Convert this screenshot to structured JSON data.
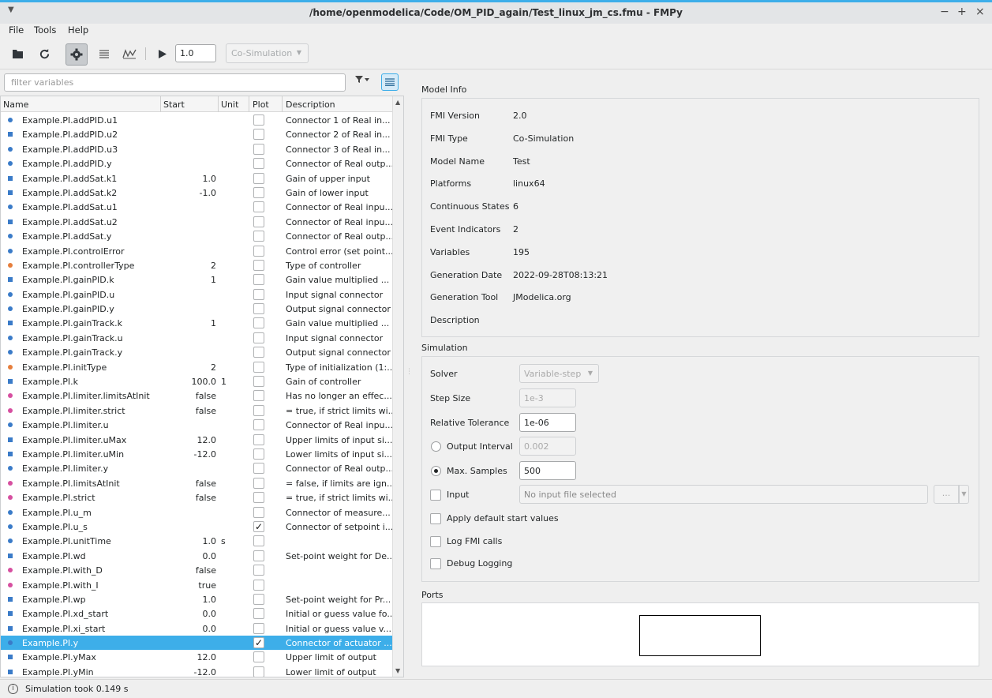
{
  "window": {
    "title": "/home/openmodelica/Code/OM_PID_again/Test_linux_jm_cs.fmu - FMPy",
    "controls": [
      "−",
      "+",
      "×"
    ]
  },
  "menu": [
    "File",
    "Tools",
    "Help"
  ],
  "toolbar": {
    "stop_time": "1.0",
    "interface_type": "Co-Simulation"
  },
  "filter": {
    "placeholder": "filter variables"
  },
  "table": {
    "columns": [
      "Name",
      "Start",
      "Unit",
      "Plot",
      "Description"
    ],
    "rows": [
      {
        "name": "Example.PI.addPID.u1",
        "start": "",
        "unit": "",
        "plot": false,
        "desc": "Connector 1 of Real in...",
        "icon": "circle",
        "color": "#3a7bc8"
      },
      {
        "name": "Example.PI.addPID.u2",
        "start": "",
        "unit": "",
        "plot": false,
        "desc": "Connector 2 of Real in...",
        "icon": "square",
        "color": "#3a7bc8"
      },
      {
        "name": "Example.PI.addPID.u3",
        "start": "",
        "unit": "",
        "plot": false,
        "desc": "Connector 3 of Real in...",
        "icon": "circle",
        "color": "#3a7bc8"
      },
      {
        "name": "Example.PI.addPID.y",
        "start": "",
        "unit": "",
        "plot": false,
        "desc": "Connector of Real outp...",
        "icon": "circle",
        "color": "#3a7bc8"
      },
      {
        "name": "Example.PI.addSat.k1",
        "start": "1.0",
        "unit": "",
        "plot": false,
        "desc": "Gain of upper input",
        "icon": "square",
        "color": "#3a7bc8"
      },
      {
        "name": "Example.PI.addSat.k2",
        "start": "-1.0",
        "unit": "",
        "plot": false,
        "desc": "Gain of lower input",
        "icon": "square",
        "color": "#3a7bc8"
      },
      {
        "name": "Example.PI.addSat.u1",
        "start": "",
        "unit": "",
        "plot": false,
        "desc": "Connector of Real inpu...",
        "icon": "circle",
        "color": "#3a7bc8"
      },
      {
        "name": "Example.PI.addSat.u2",
        "start": "",
        "unit": "",
        "plot": false,
        "desc": "Connector of Real inpu...",
        "icon": "square",
        "color": "#3a7bc8"
      },
      {
        "name": "Example.PI.addSat.y",
        "start": "",
        "unit": "",
        "plot": false,
        "desc": "Connector of Real outp...",
        "icon": "circle",
        "color": "#3a7bc8"
      },
      {
        "name": "Example.PI.controlError",
        "start": "",
        "unit": "",
        "plot": false,
        "desc": "Control error (set point...",
        "icon": "circle",
        "color": "#3a7bc8"
      },
      {
        "name": "Example.PI.controllerType",
        "start": "2",
        "unit": "",
        "plot": false,
        "desc": "Type of controller",
        "icon": "circle",
        "color": "#e67e3c"
      },
      {
        "name": "Example.PI.gainPID.k",
        "start": "1",
        "unit": "",
        "plot": false,
        "desc": "Gain value multiplied ...",
        "icon": "square",
        "color": "#3a7bc8"
      },
      {
        "name": "Example.PI.gainPID.u",
        "start": "",
        "unit": "",
        "plot": false,
        "desc": "Input signal connector",
        "icon": "circle",
        "color": "#3a7bc8"
      },
      {
        "name": "Example.PI.gainPID.y",
        "start": "",
        "unit": "",
        "plot": false,
        "desc": "Output signal connector",
        "icon": "circle",
        "color": "#3a7bc8"
      },
      {
        "name": "Example.PI.gainTrack.k",
        "start": "1",
        "unit": "",
        "plot": false,
        "desc": "Gain value multiplied ...",
        "icon": "square",
        "color": "#3a7bc8"
      },
      {
        "name": "Example.PI.gainTrack.u",
        "start": "",
        "unit": "",
        "plot": false,
        "desc": "Input signal connector",
        "icon": "circle",
        "color": "#3a7bc8"
      },
      {
        "name": "Example.PI.gainTrack.y",
        "start": "",
        "unit": "",
        "plot": false,
        "desc": "Output signal connector",
        "icon": "circle",
        "color": "#3a7bc8"
      },
      {
        "name": "Example.PI.initType",
        "start": "2",
        "unit": "",
        "plot": false,
        "desc": "Type of initialization (1:...",
        "icon": "circle",
        "color": "#e67e3c"
      },
      {
        "name": "Example.PI.k",
        "start": "100.0",
        "unit": "1",
        "plot": false,
        "desc": "Gain of controller",
        "icon": "square",
        "color": "#3a7bc8"
      },
      {
        "name": "Example.PI.limiter.limitsAtInit",
        "start": "false",
        "unit": "",
        "plot": false,
        "desc": "Has no longer an effec...",
        "icon": "circle",
        "color": "#d64fa0"
      },
      {
        "name": "Example.PI.limiter.strict",
        "start": "false",
        "unit": "",
        "plot": false,
        "desc": "= true, if strict limits wi...",
        "icon": "circle",
        "color": "#d64fa0"
      },
      {
        "name": "Example.PI.limiter.u",
        "start": "",
        "unit": "",
        "plot": false,
        "desc": "Connector of Real inpu...",
        "icon": "circle",
        "color": "#3a7bc8"
      },
      {
        "name": "Example.PI.limiter.uMax",
        "start": "12.0",
        "unit": "",
        "plot": false,
        "desc": "Upper limits of input si...",
        "icon": "square",
        "color": "#3a7bc8"
      },
      {
        "name": "Example.PI.limiter.uMin",
        "start": "-12.0",
        "unit": "",
        "plot": false,
        "desc": "Lower limits of input si...",
        "icon": "square",
        "color": "#3a7bc8"
      },
      {
        "name": "Example.PI.limiter.y",
        "start": "",
        "unit": "",
        "plot": false,
        "desc": "Connector of Real outp...",
        "icon": "circle",
        "color": "#3a7bc8"
      },
      {
        "name": "Example.PI.limitsAtInit",
        "start": "false",
        "unit": "",
        "plot": false,
        "desc": "= false, if limits are ign...",
        "icon": "circle",
        "color": "#d64fa0"
      },
      {
        "name": "Example.PI.strict",
        "start": "false",
        "unit": "",
        "plot": false,
        "desc": "= true, if strict limits wi...",
        "icon": "circle",
        "color": "#d64fa0"
      },
      {
        "name": "Example.PI.u_m",
        "start": "",
        "unit": "",
        "plot": false,
        "desc": "Connector of measure...",
        "icon": "circle",
        "color": "#3a7bc8"
      },
      {
        "name": "Example.PI.u_s",
        "start": "",
        "unit": "",
        "plot": true,
        "desc": "Connector of setpoint i...",
        "icon": "circle",
        "color": "#3a7bc8"
      },
      {
        "name": "Example.PI.unitTime",
        "start": "1.0",
        "unit": "s",
        "plot": false,
        "desc": "",
        "icon": "circle",
        "color": "#3a7bc8"
      },
      {
        "name": "Example.PI.wd",
        "start": "0.0",
        "unit": "",
        "plot": false,
        "desc": "Set-point weight for De...",
        "icon": "square",
        "color": "#3a7bc8"
      },
      {
        "name": "Example.PI.with_D",
        "start": "false",
        "unit": "",
        "plot": false,
        "desc": "",
        "icon": "circle",
        "color": "#d64fa0"
      },
      {
        "name": "Example.PI.with_I",
        "start": "true",
        "unit": "",
        "plot": false,
        "desc": "",
        "icon": "circle",
        "color": "#d64fa0"
      },
      {
        "name": "Example.PI.wp",
        "start": "1.0",
        "unit": "",
        "plot": false,
        "desc": "Set-point weight for Pr...",
        "icon": "square",
        "color": "#3a7bc8"
      },
      {
        "name": "Example.PI.xd_start",
        "start": "0.0",
        "unit": "",
        "plot": false,
        "desc": "Initial or guess value fo...",
        "icon": "square",
        "color": "#3a7bc8"
      },
      {
        "name": "Example.PI.xi_start",
        "start": "0.0",
        "unit": "",
        "plot": false,
        "desc": "Initial or guess value v...",
        "icon": "square",
        "color": "#3a7bc8"
      },
      {
        "name": "Example.PI.y",
        "start": "",
        "unit": "",
        "plot": true,
        "desc": "Connector of actuator ...",
        "icon": "circle",
        "color": "#3a7bc8",
        "selected": true
      },
      {
        "name": "Example.PI.yMax",
        "start": "12.0",
        "unit": "",
        "plot": false,
        "desc": "Upper limit of output",
        "icon": "square",
        "color": "#3a7bc8"
      },
      {
        "name": "Example.PI.yMin",
        "start": "-12.0",
        "unit": "",
        "plot": false,
        "desc": "Lower limit of output",
        "icon": "square",
        "color": "#3a7bc8"
      }
    ]
  },
  "model_info": {
    "heading": "Model Info",
    "fields": [
      {
        "label": "FMI Version",
        "value": "2.0"
      },
      {
        "label": "FMI Type",
        "value": "Co-Simulation"
      },
      {
        "label": "Model Name",
        "value": "Test"
      },
      {
        "label": "Platforms",
        "value": "linux64"
      },
      {
        "label": "Continuous States",
        "value": "6"
      },
      {
        "label": "Event Indicators",
        "value": "2"
      },
      {
        "label": "Variables",
        "value": "195"
      },
      {
        "label": "Generation Date",
        "value": "2022-09-28T08:13:21"
      },
      {
        "label": "Generation Tool",
        "value": "JModelica.org"
      },
      {
        "label": "Description",
        "value": ""
      }
    ]
  },
  "simulation": {
    "heading": "Simulation",
    "solver_label": "Solver",
    "solver_value": "Variable-step",
    "step_size_label": "Step Size",
    "step_size_value": "1e-3",
    "rel_tol_label": "Relative Tolerance",
    "rel_tol_value": "1e-06",
    "output_interval_label": "Output Interval",
    "output_interval_value": "0.002",
    "max_samples_label": "Max. Samples",
    "max_samples_value": "500",
    "input_label": "Input",
    "input_placeholder": "No input file selected",
    "browse_label": "...",
    "apply_defaults_label": "Apply default start values",
    "log_fmi_label": "Log FMI calls",
    "debug_logging_label": "Debug Logging"
  },
  "ports": {
    "heading": "Ports"
  },
  "status": {
    "text": "Simulation took 0.149 s"
  }
}
